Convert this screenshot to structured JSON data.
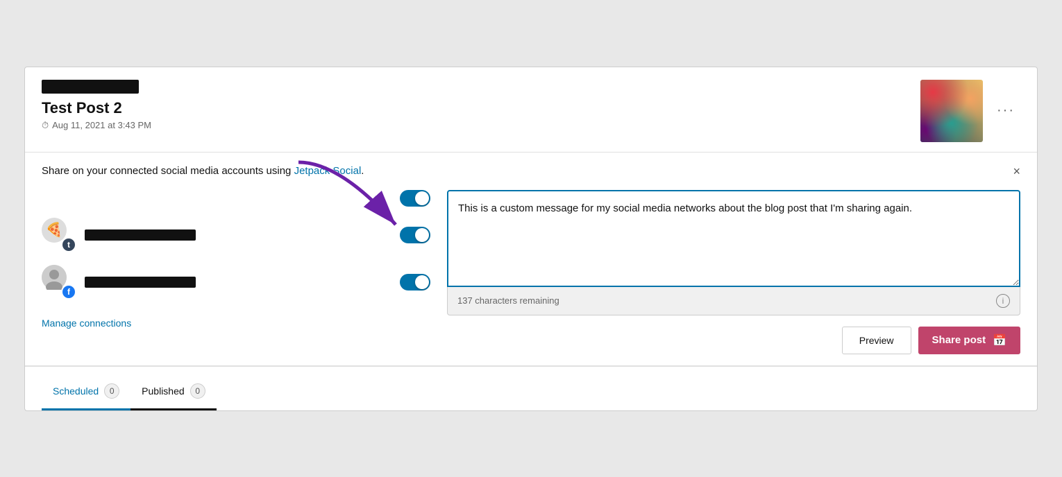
{
  "header": {
    "title": "Test Post 2",
    "date": "Aug 11, 2021 at 3:43 PM",
    "more_label": "···"
  },
  "share": {
    "intro_text": "Share on your connected social media accounts using ",
    "link_text": "Jetpack Social",
    "link_suffix": ".",
    "close_label": "×",
    "message": "This is a custom message for my social media networks about the blog post that I'm sharing again.",
    "char_remaining": "137 characters remaining",
    "preview_label": "Preview",
    "share_label": "Share post",
    "manage_label": "Manage connections"
  },
  "tabs": [
    {
      "label": "Scheduled",
      "count": "0",
      "active": true
    },
    {
      "label": "Published",
      "count": "0",
      "active": false
    }
  ]
}
